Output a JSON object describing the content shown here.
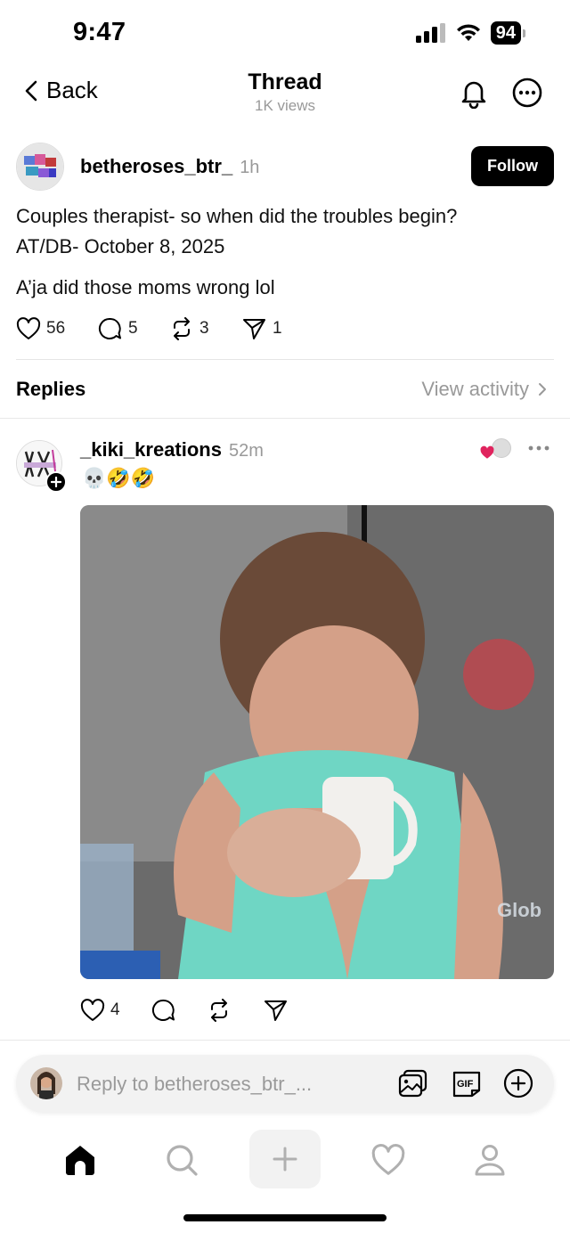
{
  "status_bar": {
    "time": "9:47",
    "battery": "94"
  },
  "header": {
    "back_label": "Back",
    "title": "Thread",
    "views": "1K views"
  },
  "post": {
    "username": "betheroses_btr_",
    "time": "1h",
    "follow_label": "Follow",
    "line1": "Couples therapist- so when did the troubles begin?",
    "line2": "AT/DB- October 8, 2025",
    "line3": "A’ja did those moms wrong lol",
    "likes": "56",
    "comments": "5",
    "reposts": "3",
    "shares": "1"
  },
  "replies_section": {
    "label": "Replies",
    "view_activity": "View activity"
  },
  "reply": {
    "username": "_kiki_kreations",
    "time": "52m",
    "emojis": "💀🤣🤣",
    "image_watermark": "Glob",
    "likes": "4"
  },
  "composer": {
    "placeholder": "Reply to betheroses_btr_..."
  },
  "icons": {
    "back": "chevron-left-icon",
    "notifications": "bell-icon",
    "more": "more-icon",
    "like": "heart-icon",
    "comment": "comment-icon",
    "repost": "repost-icon",
    "share": "send-icon",
    "nav": [
      "home-icon",
      "search-icon",
      "plus-icon",
      "heart-icon",
      "profile-icon"
    ]
  },
  "colors": {
    "accent": "#000000",
    "muted": "#999999",
    "like_red": "#e0245e"
  }
}
